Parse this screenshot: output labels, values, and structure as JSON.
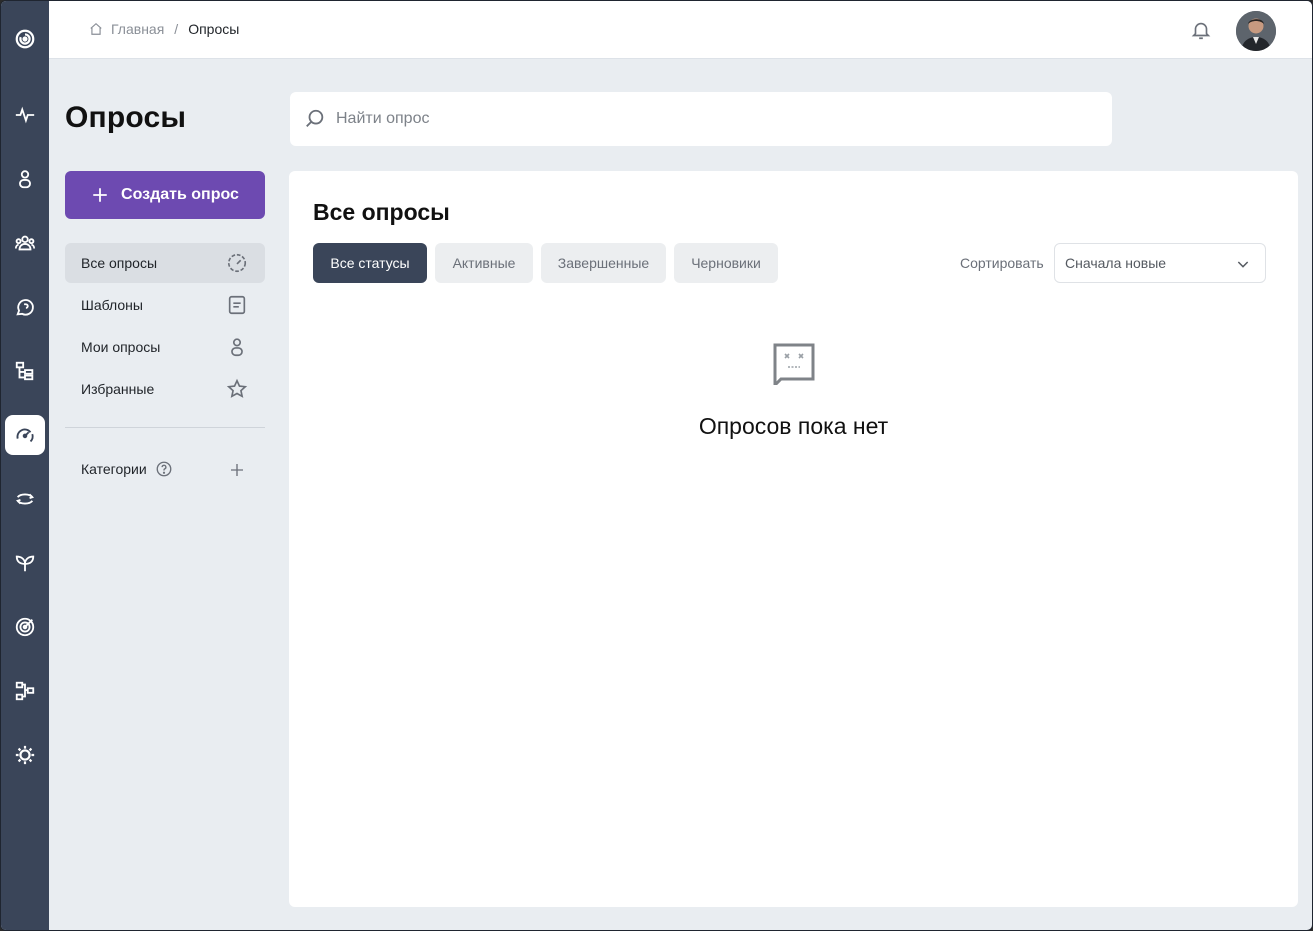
{
  "header": {
    "breadcrumb": {
      "home": "Главная",
      "separator": "/",
      "current": "Опросы"
    }
  },
  "rail": {
    "icons": [
      "logo-icon",
      "activity-icon",
      "person-icon",
      "team-icon",
      "chat-icon",
      "structure-icon",
      "survey-icon",
      "sync-icon",
      "growth-icon",
      "target-icon",
      "workflow-icon",
      "settings-icon"
    ],
    "active": "survey-icon",
    "background": "#3a4559"
  },
  "page": {
    "title": "Опросы"
  },
  "search": {
    "placeholder": "Найти опрос",
    "value": ""
  },
  "actions": {
    "create_label": "Создать опрос",
    "create_color": "#6d4ab1"
  },
  "menu": {
    "items": [
      {
        "label": "Все опросы",
        "icon": "gauge-icon",
        "active": true
      },
      {
        "label": "Шаблоны",
        "icon": "template-icon",
        "active": false
      },
      {
        "label": "Мои опросы",
        "icon": "user-icon",
        "active": false
      },
      {
        "label": "Избранные",
        "icon": "star-icon",
        "active": false
      }
    ],
    "categories_label": "Категории"
  },
  "main": {
    "title": "Все опросы",
    "filters": [
      "Все статусы",
      "Активные",
      "Завершенные",
      "Черновики"
    ],
    "active_filter": "Все статусы",
    "sort_label": "Сортировать",
    "sort_value": "Сначала новые",
    "empty_message": "Опросов пока нет"
  }
}
